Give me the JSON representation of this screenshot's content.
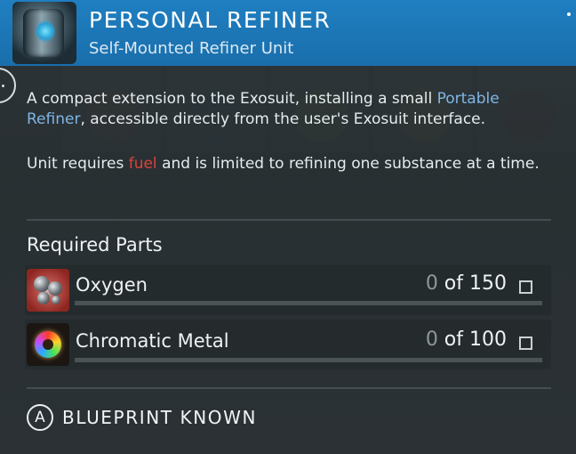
{
  "item": {
    "title": "PERSONAL REFINER",
    "subtitle": "Self-Mounted Refiner Unit",
    "icon": "portable-refiner-icon"
  },
  "description": {
    "p1_before": "A compact extension to the Exosuit, installing a small ",
    "p1_link": "Portable Refiner",
    "p1_after": ", accessible directly from the user's Exosuit interface.",
    "p2_before": "Unit requires ",
    "p2_highlight": "fuel",
    "p2_after": " and is limited to refining one substance at a time."
  },
  "required_parts": {
    "title": "Required Parts",
    "items": [
      {
        "name": "Oxygen",
        "have": "0",
        "of_label": " of 150",
        "progress": 0,
        "icon": "oxygen-icon"
      },
      {
        "name": "Chromatic Metal",
        "have": "0",
        "of_label": " of 100",
        "progress": 0,
        "icon": "chromatic-metal-icon"
      }
    ]
  },
  "blueprint": {
    "button_glyph": "A",
    "label": "BLUEPRINT KNOWN"
  },
  "colors": {
    "header": "#1f7fc1",
    "link": "#7fb6e6",
    "highlight": "#e0413a"
  }
}
